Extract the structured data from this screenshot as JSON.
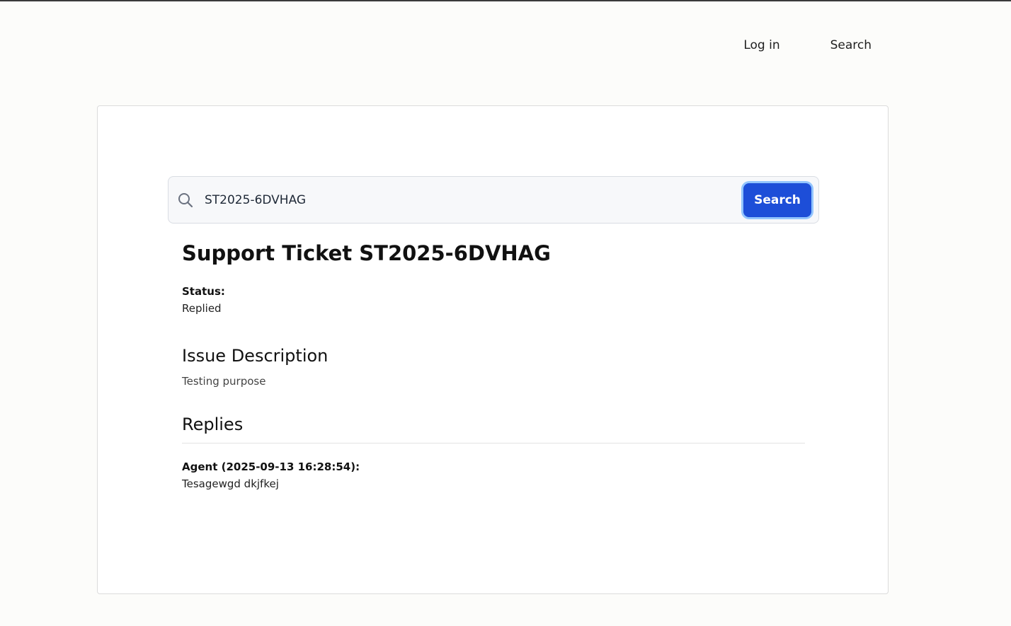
{
  "nav": {
    "login_label": "Log in",
    "search_label": "Search"
  },
  "search": {
    "value": "ST2025-6DVHAG",
    "button_label": "Search",
    "icon": "search-icon"
  },
  "ticket": {
    "title": "Support Ticket ST2025-6DVHAG",
    "status_label": "Status:",
    "status_value": "Replied",
    "issue_heading": "Issue Description",
    "issue_text": "Testing purpose",
    "replies_heading": "Replies",
    "replies": [
      {
        "meta": "Agent (2025-09-13 16:28:54):",
        "text": "Tesagewgd dkjfkej"
      }
    ]
  },
  "colors": {
    "accent": "#1d4ed8",
    "accent_ring": "#93c5fd",
    "page_bg": "#fcfcfa"
  }
}
